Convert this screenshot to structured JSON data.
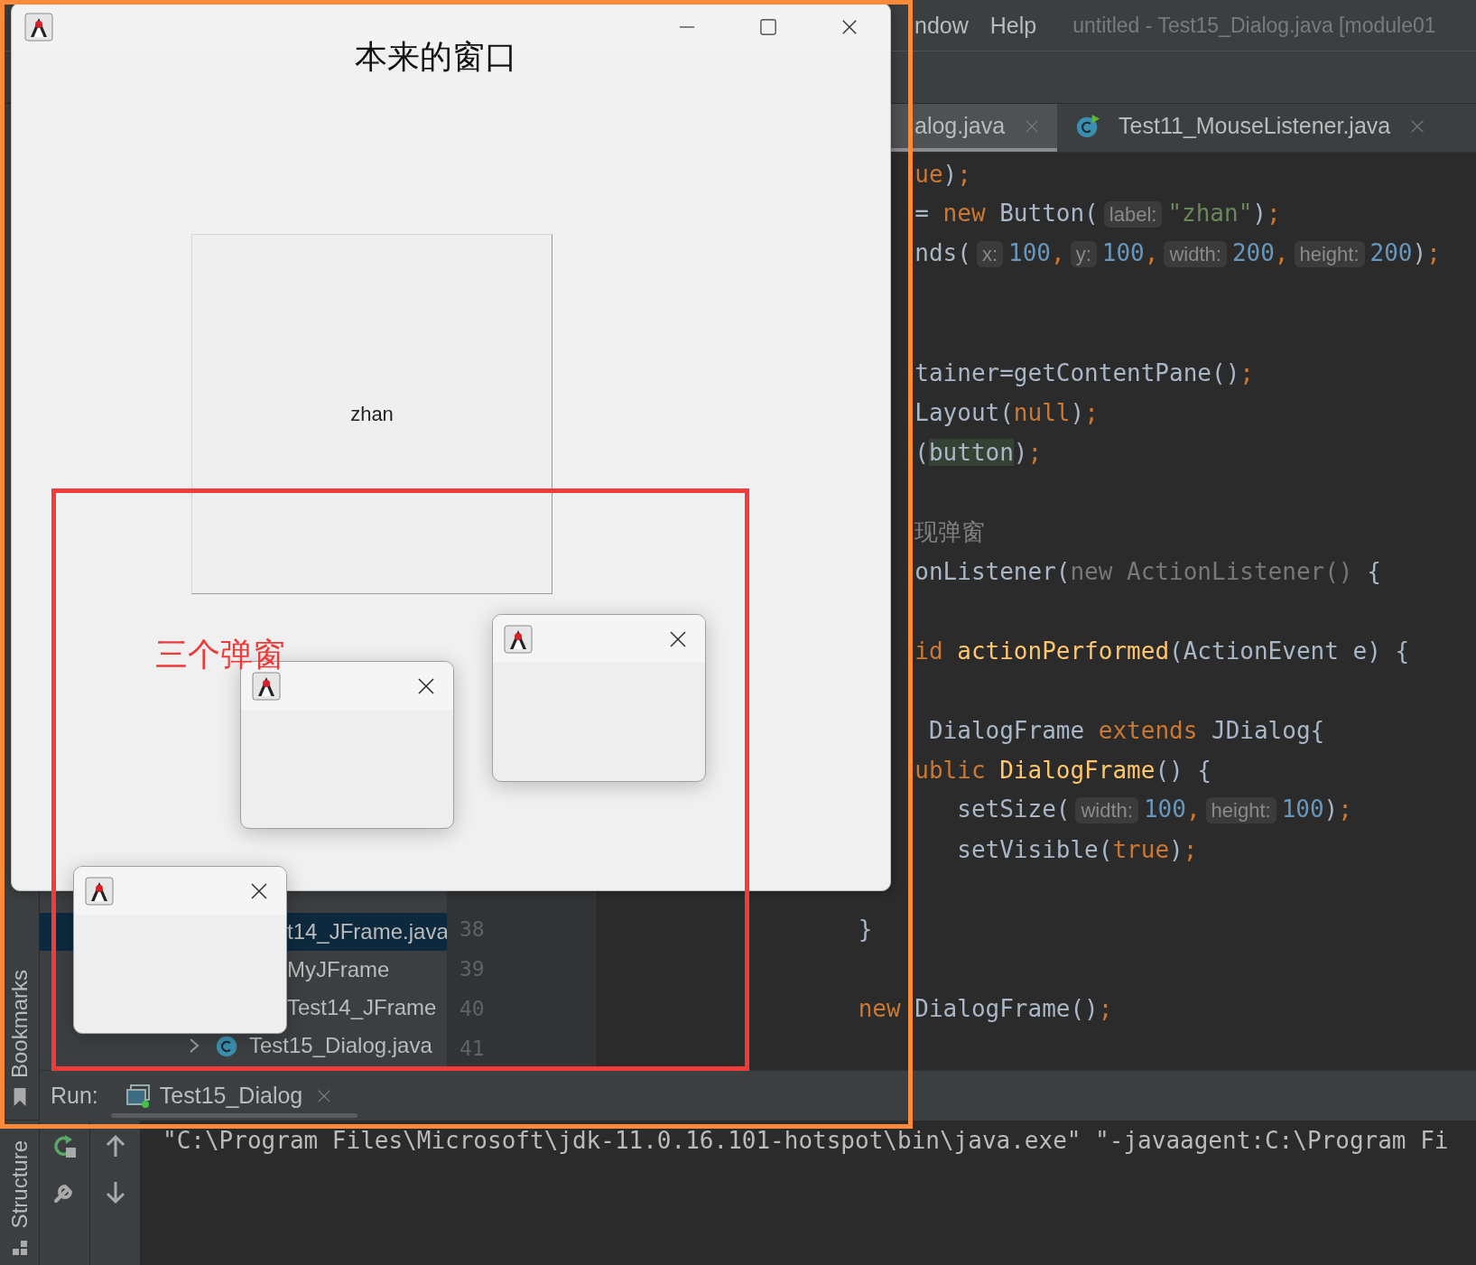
{
  "ide": {
    "menu": [
      {
        "label": "ndow"
      },
      {
        "label": "Help"
      }
    ],
    "title": "untitled - Test15_Dialog.java [module01",
    "tabs": [
      {
        "label": "alog.java",
        "selected": true
      },
      {
        "label": "Test11_MouseListener.java",
        "selected": false
      }
    ],
    "project_tree": [
      {
        "label": "t14_JFrame.java",
        "selected": true,
        "children": [
          {
            "label": "MyJFrame",
            "selected": false
          },
          {
            "label": "Test14_JFrame",
            "selected": false
          }
        ]
      },
      {
        "label": "Test15_Dialog.java",
        "selected": false,
        "expanded": false
      }
    ],
    "code_lines": [
      {
        "kind": "code",
        "tokens": [
          {
            "kind": "keyword",
            "text": "     ue"
          },
          {
            "kind": "plain",
            "text": ")"
          },
          {
            "kind": "punct",
            "text": ";"
          }
        ]
      },
      {
        "kind": "code",
        "tokens": [
          {
            "kind": "plain",
            "text": "     = "
          },
          {
            "kind": "keyword",
            "text": "new"
          },
          {
            "kind": "plain",
            "text": " Button("
          },
          {
            "kind": "hint",
            "text": "label:"
          },
          {
            "kind": "string",
            "text": "\"zhan\""
          },
          {
            "kind": "plain",
            "text": ")"
          },
          {
            "kind": "punct",
            "text": ";"
          }
        ]
      },
      {
        "kind": "code",
        "tokens": [
          {
            "kind": "plain",
            "text": "     nds("
          },
          {
            "kind": "hint",
            "text": "x:"
          },
          {
            "kind": "number",
            "text": "100"
          },
          {
            "kind": "punct",
            "text": ","
          },
          {
            "kind": "hint",
            "text": "y:"
          },
          {
            "kind": "number",
            "text": "100"
          },
          {
            "kind": "punct",
            "text": ","
          },
          {
            "kind": "hint",
            "text": "width:"
          },
          {
            "kind": "number",
            "text": "200"
          },
          {
            "kind": "punct",
            "text": ","
          },
          {
            "kind": "hint",
            "text": "height:"
          },
          {
            "kind": "number",
            "text": "200"
          },
          {
            "kind": "plain",
            "text": ")"
          },
          {
            "kind": "punct",
            "text": ";"
          }
        ]
      },
      {
        "kind": "blank"
      },
      {
        "kind": "blank"
      },
      {
        "kind": "code",
        "tokens": [
          {
            "kind": "plain",
            "text": "     tainer=getContentPane()"
          },
          {
            "kind": "punct",
            "text": ";"
          }
        ]
      },
      {
        "kind": "code",
        "tokens": [
          {
            "kind": "plain",
            "text": "     Layout("
          },
          {
            "kind": "keyword",
            "text": "null"
          },
          {
            "kind": "plain",
            "text": ")"
          },
          {
            "kind": "punct",
            "text": ";"
          }
        ]
      },
      {
        "kind": "code",
        "tokens": [
          {
            "kind": "plain",
            "text": "     ("
          },
          {
            "kind": "match",
            "text": "button"
          },
          {
            "kind": "plain",
            "text": ")"
          },
          {
            "kind": "punct",
            "text": ";"
          }
        ]
      },
      {
        "kind": "blank"
      },
      {
        "kind": "code",
        "tokens": [
          {
            "kind": "comment",
            "text": "     现弹窗"
          }
        ]
      },
      {
        "kind": "code",
        "tokens": [
          {
            "kind": "plain",
            "text": "     onListener("
          },
          {
            "kind": "dim",
            "text": "new ActionListener()"
          },
          {
            "kind": "plain",
            "text": " {"
          }
        ]
      },
      {
        "kind": "blank"
      },
      {
        "kind": "code",
        "tokens": [
          {
            "kind": "keyword",
            "text": "     id"
          },
          {
            "kind": "method",
            "text": " actionPerformed"
          },
          {
            "kind": "plain",
            "text": "(ActionEvent e) {"
          }
        ]
      },
      {
        "kind": "blank"
      },
      {
        "kind": "code",
        "tokens": [
          {
            "kind": "plain",
            "text": "      DialogFrame"
          },
          {
            "kind": "keyword",
            "text": " extends"
          },
          {
            "kind": "plain",
            "text": " JDialog{"
          }
        ]
      },
      {
        "kind": "code",
        "tokens": [
          {
            "kind": "keyword",
            "text": "     ublic"
          },
          {
            "kind": "method",
            "text": " DialogFrame"
          },
          {
            "kind": "plain",
            "text": "() {"
          }
        ]
      },
      {
        "kind": "code",
        "tokens": [
          {
            "kind": "plain",
            "text": "        setSize("
          },
          {
            "kind": "hint",
            "text": "width:"
          },
          {
            "kind": "number",
            "text": "100"
          },
          {
            "kind": "punct",
            "text": ","
          },
          {
            "kind": "hint",
            "text": "height:"
          },
          {
            "kind": "number",
            "text": "100"
          },
          {
            "kind": "plain",
            "text": ")"
          },
          {
            "kind": "punct",
            "text": ";"
          }
        ]
      },
      {
        "kind": "code",
        "tokens": [
          {
            "kind": "plain",
            "text": "        setVisible("
          },
          {
            "kind": "keyword",
            "text": "true"
          },
          {
            "kind": "plain",
            "text": ")"
          },
          {
            "kind": "punct",
            "text": ";"
          }
        ]
      },
      {
        "kind": "blank"
      },
      {
        "kind": "code",
        "number": "38",
        "tokens": [
          {
            "kind": "plain",
            "text": " }"
          }
        ]
      },
      {
        "kind": "code",
        "number": "39"
      },
      {
        "kind": "code",
        "number": "40",
        "tokens": [
          {
            "kind": "keyword",
            "text": " new"
          },
          {
            "kind": "plain",
            "text": " DialogFrame()"
          },
          {
            "kind": "punct",
            "text": ";"
          }
        ]
      },
      {
        "kind": "code",
        "number": "41"
      }
    ],
    "tool_windows": [
      {
        "kind": "bookmarks",
        "label": "Bookmarks"
      },
      {
        "kind": "structure",
        "label": "Structure"
      }
    ],
    "run": {
      "label": "Run:",
      "tab": "Test15_Dialog"
    },
    "console": [
      "\"C:\\Program Files\\Microsoft\\jdk-11.0.16.101-hotspot\\bin\\java.exe\" \"-javaagent:C:\\Program Fi"
    ]
  },
  "main_window": {
    "heading": "本来的窗口",
    "button": "zhan"
  },
  "dialogs": [
    {
      "closable": true
    },
    {
      "closable": true
    },
    {
      "closable": true
    }
  ],
  "annotation": {
    "label": "三个弹窗"
  }
}
